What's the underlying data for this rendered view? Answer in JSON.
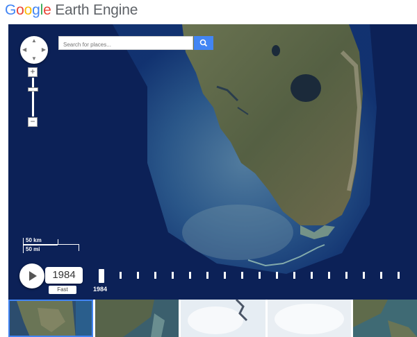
{
  "header": {
    "logo_google_letters": [
      "G",
      "o",
      "o",
      "g",
      "l",
      "e"
    ],
    "logo_product": "Earth Engine"
  },
  "map": {
    "search": {
      "placeholder": "Search for places..."
    },
    "scale": {
      "metric": "50 km",
      "imperial": "50 mi"
    },
    "zoom": {
      "in_label": "+",
      "out_label": "−",
      "level_fraction": 0.75
    },
    "icons": {
      "pan": "pan-arrows-icon",
      "search": "search-icon",
      "play": "play-icon"
    }
  },
  "timelapse": {
    "current_year": "1984",
    "speed_label": "Fast",
    "timeline_label": "1984",
    "tick_count": 17
  },
  "thumbnails": [
    {
      "name": "thumb-1",
      "selected": true
    },
    {
      "name": "thumb-2",
      "selected": false
    },
    {
      "name": "thumb-3",
      "selected": false
    },
    {
      "name": "thumb-4",
      "selected": false
    },
    {
      "name": "thumb-5",
      "selected": false
    }
  ],
  "colors": {
    "accent": "#4285f4",
    "ocean": "#0b1f52",
    "land": "#4f5e3a"
  }
}
